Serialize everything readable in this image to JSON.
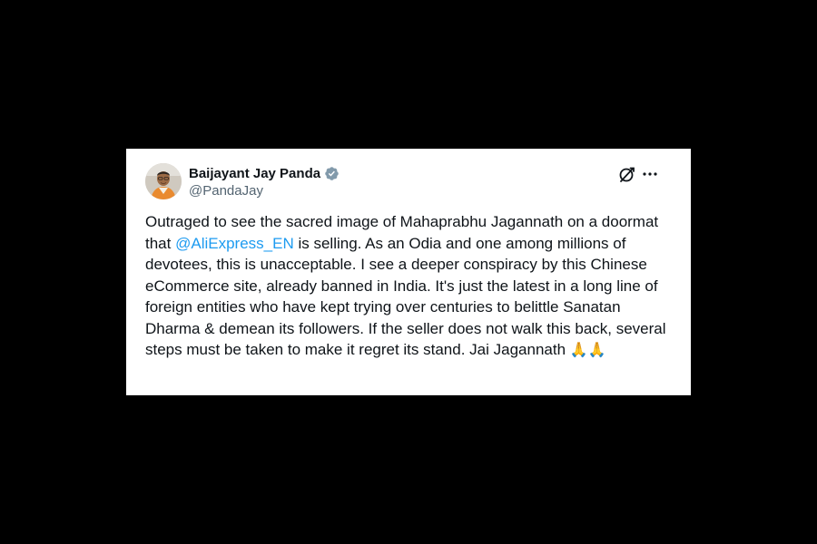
{
  "author": {
    "name": "Baijayant Jay Panda",
    "handle": "@PandaJay",
    "verified": true
  },
  "header_icons": {
    "grok": "grok-icon",
    "more": "more-horizontal-icon"
  },
  "tweet": {
    "text_before_mention": "Outraged to see the sacred image of Mahaprabhu Jagannath on a doormat that ",
    "mention": "@AliExpress_EN",
    "text_after_mention": " is selling. As an Odia and one among millions of devotees, this is unacceptable. I see a deeper conspiracy by this Chinese eCommerce site, already banned in India. It's just the latest in a long line of foreign entities who have kept trying over centuries to belittle Sanatan Dharma & demean its followers. If the seller does not walk this back, several steps must be taken to make it regret its stand. Jai Jagannath ",
    "emoji": "🙏🙏"
  },
  "colors": {
    "background": "#000000",
    "card": "#ffffff",
    "text": "#0f1419",
    "secondary_text": "#536471",
    "link": "#1d9bf0"
  }
}
